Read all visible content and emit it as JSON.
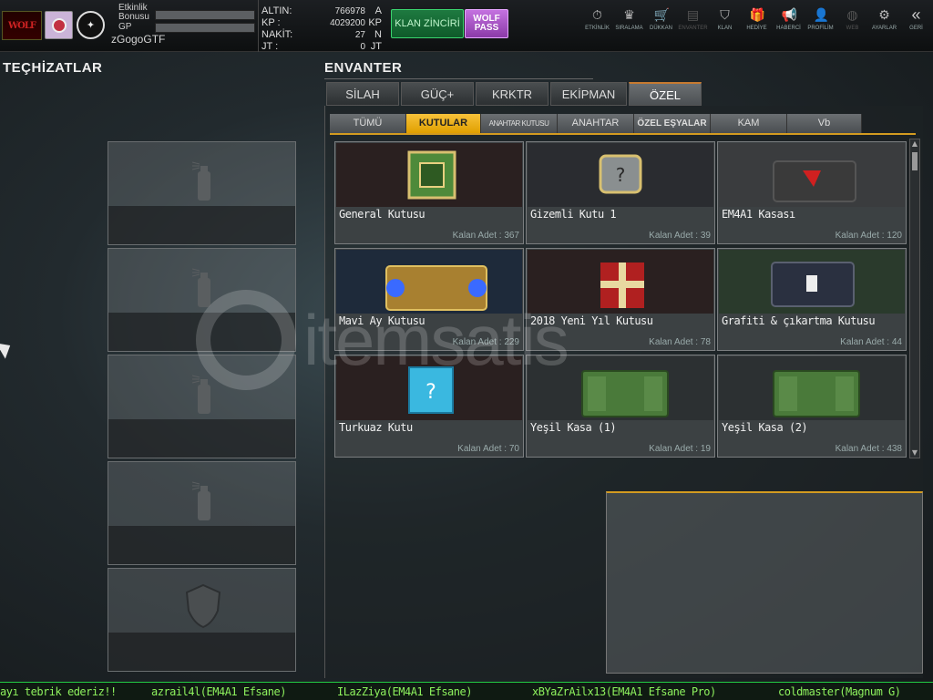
{
  "header": {
    "logo_text": "WOLF",
    "bonus_label": "Etkinlik Bonusu",
    "gp_label": "GP",
    "username": "zGogoGTF",
    "currency": [
      {
        "label": "ALTIN:",
        "value": "766978",
        "unit": "A"
      },
      {
        "label": "KP :",
        "value": "4029200",
        "unit": "KP"
      },
      {
        "label": "NAKİT:",
        "value": "27",
        "unit": "N"
      },
      {
        "label": "JT :",
        "value": "0",
        "unit": "JT"
      }
    ],
    "klan_button": "KLAN ZİNCİRİ",
    "wolf_pass_line1": "WOLF",
    "wolf_pass_line2": "PASS"
  },
  "nav": [
    {
      "label": "ETKİNLİK",
      "icon": "stopwatch-icon",
      "glyph": "⏱",
      "enabled": true
    },
    {
      "label": "SIRALAMA",
      "icon": "ranking-badge-icon",
      "glyph": "♛",
      "enabled": true
    },
    {
      "label": "DÜKKAN",
      "icon": "cart-icon",
      "glyph": "🛒",
      "enabled": true
    },
    {
      "label": "ENVANTER",
      "icon": "inventory-icon",
      "glyph": "▤",
      "enabled": false
    },
    {
      "label": "KLAN",
      "icon": "shield-icon",
      "glyph": "⛉",
      "enabled": true
    },
    {
      "label": "HEDİYE",
      "icon": "gift-icon",
      "glyph": "🎁",
      "enabled": true
    },
    {
      "label": "HABERCİ",
      "icon": "megaphone-icon",
      "glyph": "📢",
      "enabled": true
    },
    {
      "label": "PROFİLİM",
      "icon": "profile-icon",
      "glyph": "👤",
      "enabled": true
    },
    {
      "label": "WEB",
      "icon": "globe-icon",
      "glyph": "◍",
      "enabled": false
    },
    {
      "label": "AYARLAR",
      "icon": "gear-icon",
      "glyph": "⚙",
      "enabled": true
    },
    {
      "label": "GERİ",
      "icon": "back-chevron-icon",
      "glyph": "«",
      "enabled": true
    }
  ],
  "left": {
    "title": "TEÇHİZATLAR"
  },
  "inventory": {
    "title": "ENVANTER",
    "tabs": [
      "SİLAH",
      "GÜÇ+",
      "KRKTR",
      "EKİPMAN",
      "ÖZEL"
    ],
    "active_tab": "ÖZEL",
    "subtabs": [
      "TÜMÜ",
      "KUTULAR",
      "ANAHTAR KUTUSU",
      "ANAHTAR",
      "ÖZEL EŞYALAR",
      "KAM",
      "Vb"
    ],
    "active_subtab": "KUTULAR",
    "count_label": "Kalan Adet :",
    "items": [
      {
        "name": "General Kutusu",
        "count": "367",
        "theme": "green-cube"
      },
      {
        "name": "Gizemli Kutu 1",
        "count": "39",
        "theme": "mystery"
      },
      {
        "name": "EM4A1 Kasası",
        "count": "120",
        "theme": "red-case"
      },
      {
        "name": "Mavi Ay Kutusu",
        "count": "229",
        "theme": "moon-chest"
      },
      {
        "name": "2018 Yeni Yıl Kutusu",
        "count": "78",
        "theme": "gift-box"
      },
      {
        "name": "Grafiti & çıkartma Kutusu",
        "count": "44",
        "theme": "graffiti-case"
      },
      {
        "name": "Turkuaz Kutu",
        "count": "70",
        "theme": "turquoise"
      },
      {
        "name": "Yeşil Kasa (1)",
        "count": "19",
        "theme": "green-crate"
      },
      {
        "name": "Yeşil Kasa (2)",
        "count": "438",
        "theme": "green-crate"
      }
    ]
  },
  "ticker": [
    "ayı tebrik ederiz!!",
    "azrail4l(EM4A1 Efsane)",
    "ILazZiya(EM4A1 Efsane)",
    "xBYaZrAilx13(EM4A1 Efsane Pro)",
    "coldmaster(Magnum G)"
  ],
  "watermark": "itemsatis"
}
